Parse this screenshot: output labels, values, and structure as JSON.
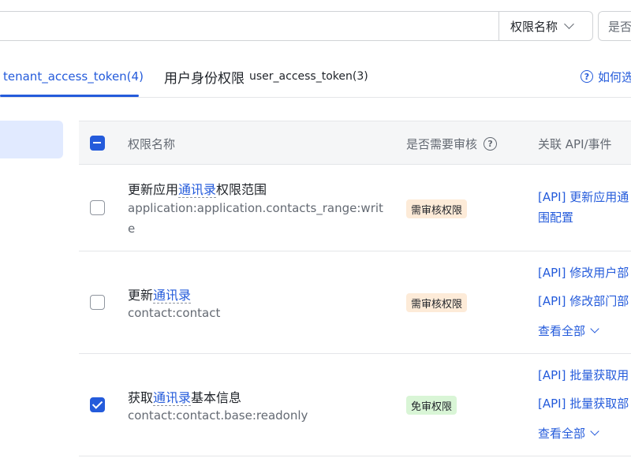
{
  "filter": {
    "search_placeholder": "",
    "select_label": "权限名称",
    "select2_label": "是否"
  },
  "tabs": {
    "tenant": "tenant_access_token(4)",
    "user_cn": "用户身份权限",
    "user_en": "user_access_token(3)",
    "help": "如何选"
  },
  "table": {
    "headers": {
      "name": "权限名称",
      "review": "是否需要审核",
      "api": "关联 API/事件"
    },
    "rows": [
      {
        "title_pre": "更新应用",
        "title_link": "通讯录",
        "title_post": "权限范围",
        "code": "application:application.contacts_range:write",
        "badge": "需审核权限",
        "apis": [
          "[API] 更新应用通讯录权限范围配置"
        ],
        "api_line1": "[API] 更新应用通",
        "api_line2": "围配置",
        "view_all": "",
        "checked": false
      },
      {
        "title_pre": "更新",
        "title_link": "通讯录",
        "title_post": "",
        "code": "contact:contact",
        "badge": "需审核权限",
        "api_line1": "[API] 修改用户部",
        "api_line2": "[API] 修改部门部",
        "view_all": "查看全部",
        "checked": false
      },
      {
        "title_pre": "获取",
        "title_link": "通讯录",
        "title_post": "基本信息",
        "code": "contact:contact.base:readonly",
        "badge": "免审权限",
        "api_line1": "[API] 批量获取用",
        "api_line2": "[API] 批量获取部",
        "view_all": "查看全部",
        "checked": true
      }
    ]
  },
  "colors": {
    "accent": "#245bdb",
    "review_badge_bg": "#fdebd8",
    "free_badge_bg": "#d9f5d6"
  }
}
